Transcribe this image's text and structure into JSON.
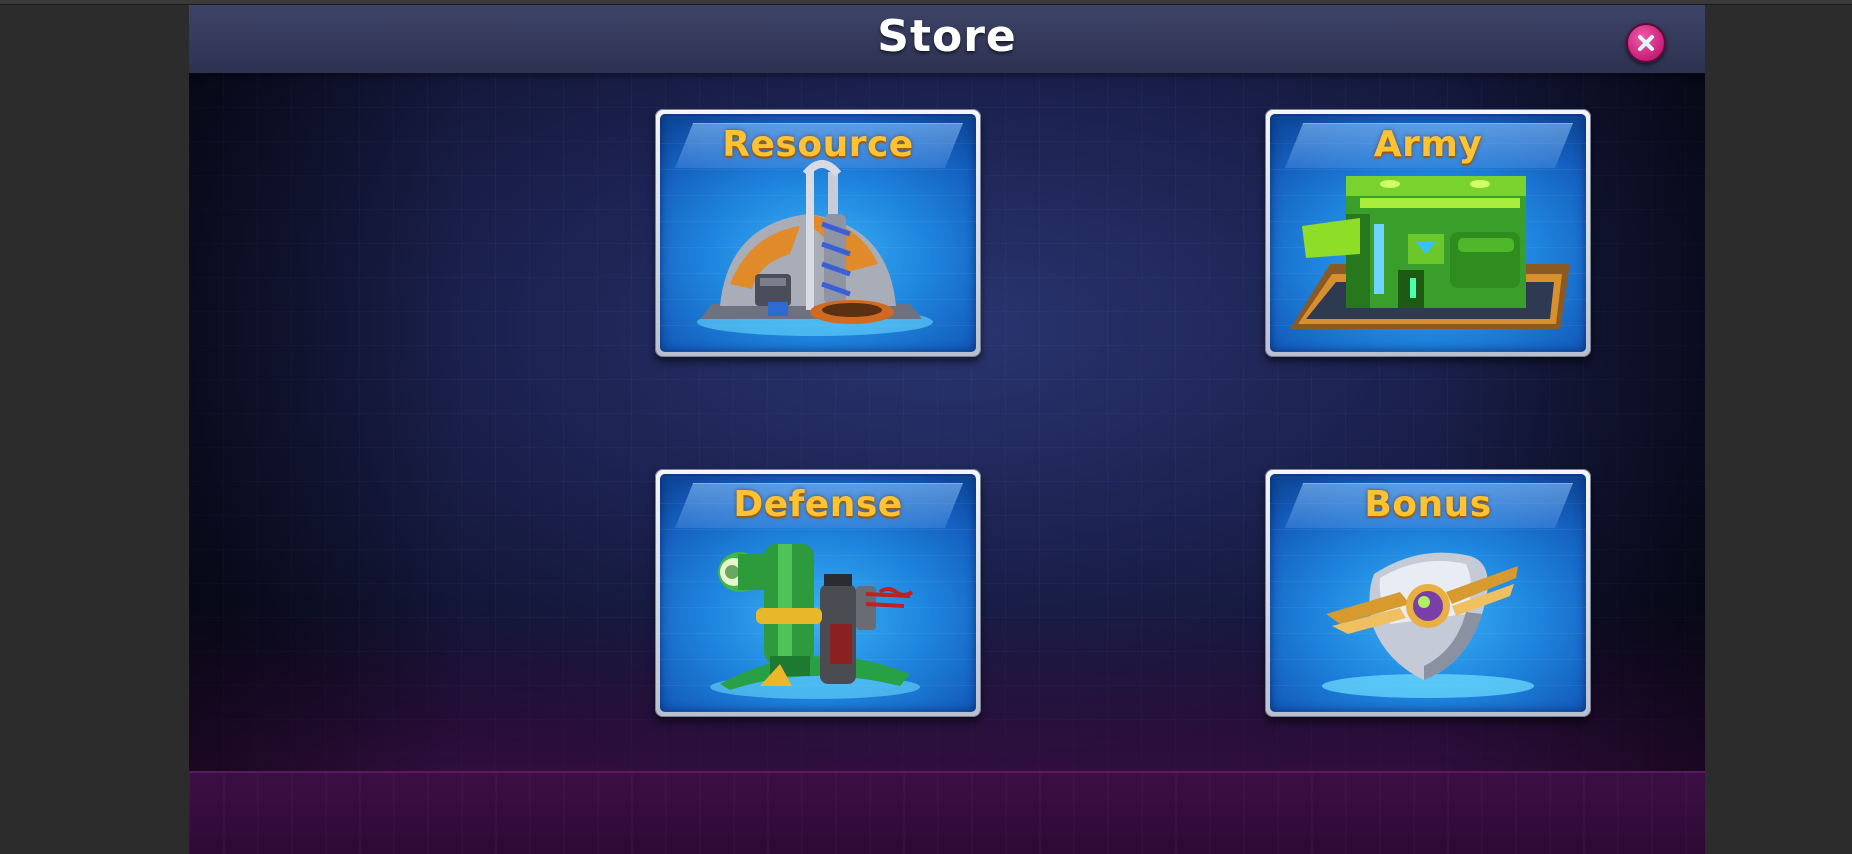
{
  "window": {
    "title": "Store"
  },
  "header": {
    "close_icon": "close-icon",
    "close_color": "#c71f78"
  },
  "cards": [
    {
      "label": "Resource",
      "icon": "resource-building-icon"
    },
    {
      "label": "Army",
      "icon": "army-barracks-icon"
    },
    {
      "label": "Defense",
      "icon": "defense-turret-icon"
    },
    {
      "label": "Bonus",
      "icon": "bonus-shield-icon"
    }
  ],
  "colors": {
    "label": "#ffc233",
    "card_bg": "#1f86df",
    "panel_bg": "#1d2352"
  }
}
